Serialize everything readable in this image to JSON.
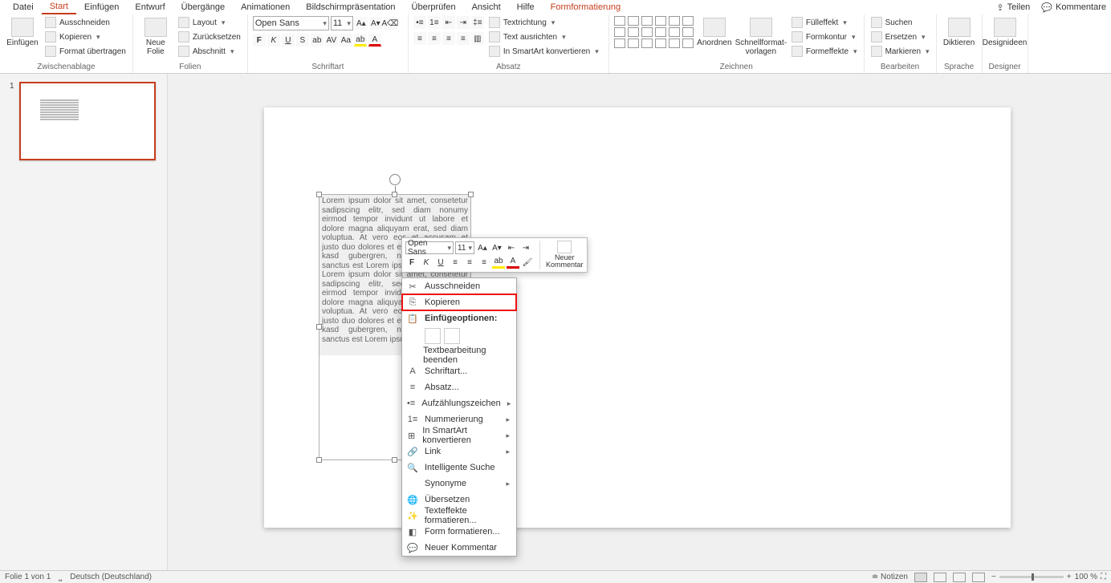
{
  "tabs": [
    "Datei",
    "Start",
    "Einfügen",
    "Entwurf",
    "Übergänge",
    "Animationen",
    "Bildschirmpräsentation",
    "Überprüfen",
    "Ansicht",
    "Hilfe",
    "Formformatierung"
  ],
  "activeTab": "Start",
  "titlebar": {
    "share": "Teilen",
    "comments": "Kommentare"
  },
  "ribbon": {
    "clipboard": {
      "label": "Zwischenablage",
      "paste": "Einfügen",
      "cut": "Ausschneiden",
      "copy": "Kopieren",
      "formatPainter": "Format übertragen"
    },
    "slides": {
      "label": "Folien",
      "newSlide": "Neue\nFolie",
      "layout": "Layout",
      "reset": "Zurücksetzen",
      "section": "Abschnitt"
    },
    "font": {
      "label": "Schriftart",
      "name": "Open Sans",
      "size": "11"
    },
    "paragraph": {
      "label": "Absatz",
      "textDirection": "Textrichtung",
      "alignText": "Text ausrichten",
      "convertSmartArt": "In SmartArt konvertieren"
    },
    "drawing": {
      "label": "Zeichnen",
      "arrange": "Anordnen",
      "quickStyles": "Schnellformat-\nvorlagen",
      "shapeFill": "Fülleffekt",
      "shapeOutline": "Formkontur",
      "shapeEffects": "Formeffekte"
    },
    "editing": {
      "label": "Bearbeiten",
      "find": "Suchen",
      "replace": "Ersetzen",
      "select": "Markieren"
    },
    "voice": {
      "label": "Sprache",
      "dictate": "Diktieren"
    },
    "designer": {
      "label": "Designer",
      "ideas": "Designideen"
    }
  },
  "thumb": {
    "number": "1"
  },
  "textbox": {
    "text": "Lorem ipsum dolor sit amet, consetetur sadipscing elitr, sed diam nonumy eirmod tempor invidunt ut labore et dolore magna aliquyam erat, sed diam voluptua. At vero eos et accusam et justo duo dolores et ea rebum. Stet clita kasd gubergren, no sea takimata sanctus est Lorem ipsum dolor sit amet. Lorem ipsum dolor sit amet, consetetur sadipscing elitr, sed diam nonumy eirmod tempor invidunt ut labore et dolore magna aliquyam erat, sed diam voluptua. At vero eos et accusam et justo duo dolores et ea rebum. Stet clita kasd gubergren, no sea takimata sanctus est Lorem ipsum dolor sit amet."
  },
  "miniToolbar": {
    "font": "Open Sans",
    "size": "11",
    "newComment": "Neuer\nKommentar"
  },
  "contextMenu": {
    "cut": "Ausschneiden",
    "copy": "Kopieren",
    "pasteOptionsHeader": "Einfügeoptionen:",
    "exitEdit": "Textbearbeitung beenden",
    "font": "Schriftart...",
    "paragraph": "Absatz...",
    "bullets": "Aufzählungszeichen",
    "numbering": "Nummerierung",
    "convertSmartArt": "In SmartArt konvertieren",
    "link": "Link",
    "smartLookup": "Intelligente Suche",
    "synonyms": "Synonyme",
    "translate": "Übersetzen",
    "textEffects": "Texteffekte formatieren...",
    "formatShape": "Form formatieren...",
    "newComment": "Neuer Kommentar"
  },
  "status": {
    "slideInfo": "Folie 1 von 1",
    "language": "Deutsch (Deutschland)",
    "notes": "Notizen",
    "zoom": "100 %"
  }
}
